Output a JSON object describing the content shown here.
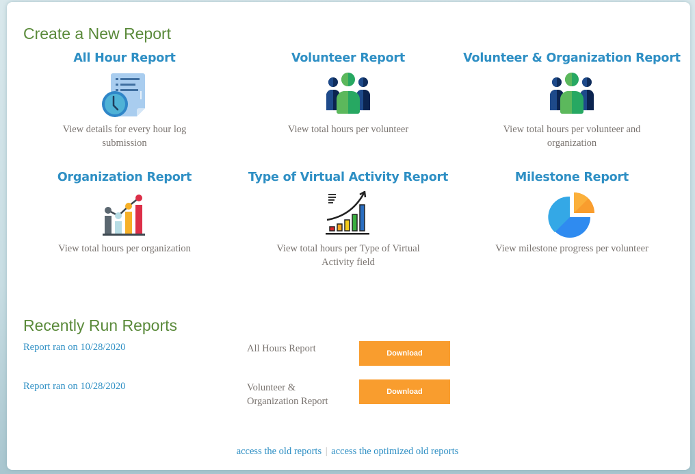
{
  "create": {
    "title": "Create a New Report",
    "tiles": [
      {
        "title": "All Hour Report",
        "icon": "document-clock-icon",
        "description": "View details for every hour log submission"
      },
      {
        "title": "Volunteer Report",
        "icon": "people-group-icon",
        "description": "View total hours per volunteer"
      },
      {
        "title": "Volunteer & Organization Report",
        "icon": "people-group-icon",
        "description": "View total hours per volunteer and organization"
      },
      {
        "title": "Organization Report",
        "icon": "bar-line-chart-icon",
        "description": "View total hours per organization"
      },
      {
        "title": "Type of Virtual Activity Report",
        "icon": "growth-chart-icon",
        "description": "View total hours per Type of Virtual Activity field"
      },
      {
        "title": "Milestone Report",
        "icon": "pie-chart-icon",
        "description": "View milestone progress per volunteer"
      }
    ]
  },
  "recent": {
    "title": "Recently Run Reports",
    "rows": [
      {
        "link": "Report ran on 10/28/2020",
        "name": "All Hours Report",
        "button": "Download"
      },
      {
        "link": "Report ran on 10/28/2020",
        "name": "Volunteer & Organization Report",
        "button": "Download"
      }
    ]
  },
  "footer": {
    "old_reports": "access the old reports",
    "separator": "|",
    "optimized_old_reports": "access the optimized old reports"
  },
  "colors": {
    "section_title": "#5a8a3a",
    "link": "#2e8fc4",
    "button": "#f99d2e",
    "description": "#7a7470"
  }
}
